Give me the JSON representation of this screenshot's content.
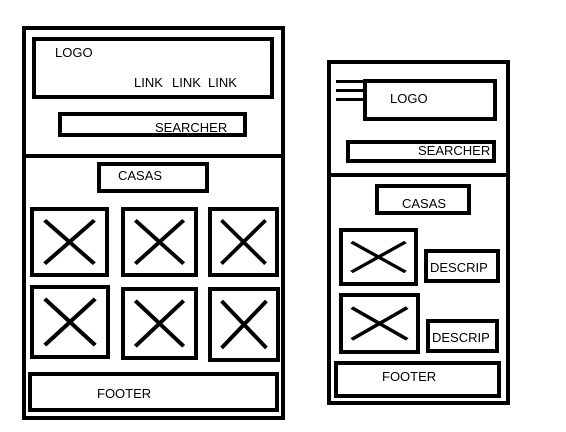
{
  "desktop": {
    "logo": "LOGO",
    "links": [
      "LINK",
      "LINK",
      "LINK"
    ],
    "searcher": "SEARCHER",
    "casas": "CASAS",
    "footer": "FOOTER",
    "image_count": 6
  },
  "mobile": {
    "menu_icon": "hamburger-menu-icon",
    "logo": "LOGO",
    "searcher": "SEARCHER",
    "casas": "CASAS",
    "descriptions": [
      "DESCRIP",
      "DESCRIP"
    ],
    "footer": "FOOTER",
    "image_count": 2
  }
}
